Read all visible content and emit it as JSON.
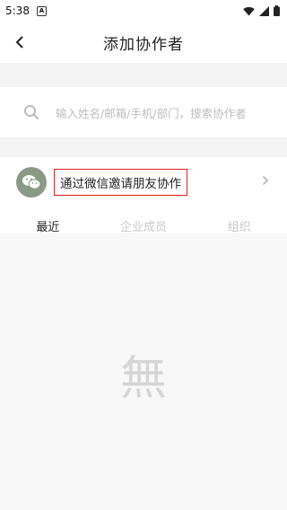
{
  "status_bar": {
    "time": "5:38",
    "app_icon": "A"
  },
  "header": {
    "title": "添加协作者"
  },
  "search": {
    "placeholder": "输入姓名/邮箱/手机/部门，搜索协作者"
  },
  "invite": {
    "label": "通过微信邀请朋友协作"
  },
  "tabs": [
    {
      "label": "最近",
      "active": true
    },
    {
      "label": "企业成员",
      "active": false
    },
    {
      "label": "组织",
      "active": false
    }
  ],
  "empty_state": {
    "text": "無"
  },
  "colors": {
    "highlight_border": "#e02020",
    "avatar_bg": "#8a9a86"
  }
}
